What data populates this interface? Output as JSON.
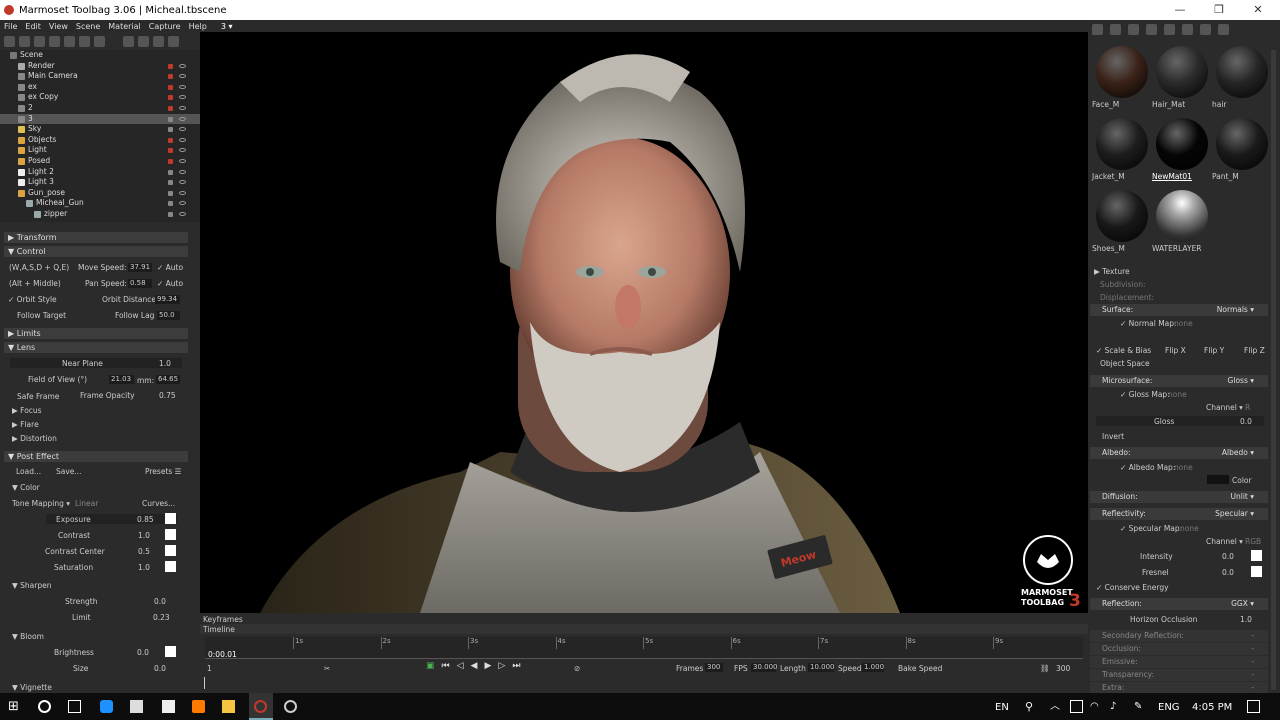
{
  "window": {
    "title": "Marmoset Toolbag 3.06  |  Micheal.tbscene",
    "minimize": "—",
    "maximize": "❐",
    "close": "✕"
  },
  "menu": [
    "File",
    "Edit",
    "View",
    "Scene",
    "Material",
    "Capture",
    "Help"
  ],
  "viewport_label": "3 ▾",
  "scene_tree": [
    {
      "name": "Scene",
      "indent": 0,
      "icon": "scene-icon",
      "lock": "none"
    },
    {
      "name": "Render",
      "indent": 1,
      "icon": "render-icon",
      "lock": "red"
    },
    {
      "name": "Main Camera",
      "indent": 1,
      "icon": "camera-icon",
      "lock": "red"
    },
    {
      "name": "ex",
      "indent": 1,
      "icon": "camera-icon",
      "lock": "red"
    },
    {
      "name": "ex Copy",
      "indent": 1,
      "icon": "camera-icon",
      "lock": "red"
    },
    {
      "name": "2",
      "indent": 1,
      "icon": "camera-icon",
      "lock": "red"
    },
    {
      "name": "3",
      "indent": 1,
      "icon": "camera-icon",
      "lock": "gray",
      "selected": true
    },
    {
      "name": "Sky",
      "indent": 1,
      "icon": "sky-icon",
      "lock": "gray"
    },
    {
      "name": "Objects",
      "indent": 1,
      "icon": "folder-icon",
      "lock": "red"
    },
    {
      "name": "Light",
      "indent": 1,
      "icon": "folder-icon",
      "lock": "red"
    },
    {
      "name": "Posed",
      "indent": 1,
      "icon": "folder-icon",
      "lock": "red"
    },
    {
      "name": "Light 2",
      "indent": 1,
      "icon": "light-icon",
      "lock": "gray"
    },
    {
      "name": "Light 3",
      "indent": 1,
      "icon": "light-icon",
      "lock": "gray"
    },
    {
      "name": "Gun_pose",
      "indent": 1,
      "icon": "folder-icon",
      "lock": "gray"
    },
    {
      "name": "Micheal_Gun",
      "indent": 2,
      "icon": "mesh-icon",
      "lock": "gray"
    },
    {
      "name": "zipper",
      "indent": 3,
      "icon": "mesh-icon",
      "lock": "gray"
    }
  ],
  "left": {
    "transform": "Transform",
    "control": "Control",
    "wasd": "(W,A,S,D + Q,E)",
    "move_speed_label": "Move Speed:",
    "move_speed": "37.91",
    "auto1": "✓ Auto",
    "alt_middle": "(Alt + Middle)",
    "pan_speed_label": "Pan Speed:",
    "pan_speed": "0.58",
    "auto2": "✓ Auto",
    "orbit_style": "✓ Orbit Style",
    "orbit_dist_label": "Orbit Distance:",
    "orbit_dist": "99.34",
    "follow_target": "Follow Target",
    "follow_lag_label": "Follow Lag",
    "follow_lag": "50.0",
    "limits": "Limits",
    "lens": "Lens",
    "near_plane_label": "Near Plane",
    "near_plane": "1.0",
    "fov_label": "Field of View (°)",
    "fov": "21.03",
    "mm_label": "mm:",
    "mm": "64.65",
    "safe_frame": "Safe Frame",
    "frame_opacity_label": "Frame Opacity",
    "frame_opacity": "0.75",
    "focus": "Focus",
    "flare": "Flare",
    "distortion": "Distortion",
    "post_effect": "Post Effect",
    "load": "Load...",
    "save": "Save...",
    "presets": "Presets ☰",
    "color": "Color",
    "tone_mapping": "Tone Mapping ▾",
    "tone_value": "Linear",
    "curves": "Curves...",
    "exposure_label": "Exposure",
    "exposure": "0.85",
    "contrast_label": "Contrast",
    "contrast": "1.0",
    "contrast_center_label": "Contrast Center",
    "contrast_center": "0.5",
    "saturation_label": "Saturation",
    "saturation": "1.0",
    "sharpen": "Sharpen",
    "strength_label": "Strength",
    "strength": "0.0",
    "limit_label": "Limit",
    "limit": "0.23",
    "bloom": "Bloom",
    "brightness_label": "Brightness",
    "brightness": "0.0",
    "size_label": "Size",
    "size": "0.0",
    "vignette": "Vignette"
  },
  "materials": [
    {
      "name": "Face_M",
      "color": "#3a2218"
    },
    {
      "name": "Hair_Mat",
      "color": "#2a2a2a"
    },
    {
      "name": "hair",
      "color": "#252525"
    },
    {
      "name": "Jacket_M",
      "color": "#1d1d1d"
    },
    {
      "name": "NewMat01",
      "color": "#050505"
    },
    {
      "name": "Pant_M",
      "color": "#1a1a1a"
    },
    {
      "name": "Shoes_M",
      "color": "#181818"
    },
    {
      "name": "WATERLAYER",
      "color": "#8a8a8a"
    }
  ],
  "right": {
    "texture": "Texture",
    "subdivision": "Subdivision:",
    "displacement": "Displacement:",
    "surface": "Surface:",
    "surface_val": "Normals ▾",
    "normal_map": "✓ Normal Map:",
    "normal_map_val": "none",
    "scale_bias": "✓ Scale & Bias",
    "flip_x": "Flip X",
    "flip_y": "Flip Y",
    "flip_z": "Flip Z",
    "object_space": "Object Space",
    "microsurface": "Microsurface:",
    "micro_val": "Gloss ▾",
    "gloss_map": "✓ Gloss Map:",
    "gloss_map_val": "none",
    "channel": "Channel ▾",
    "channel_r": "R",
    "gloss_label": "Gloss",
    "gloss": "0.0",
    "invert": "Invert",
    "albedo": "Albedo:",
    "albedo_val": "Albedo ▾",
    "albedo_map": "✓ Albedo Map:",
    "albedo_map_val": "none",
    "color_label": "Color",
    "diffusion": "Diffusion:",
    "diffusion_val": "Unlit ▾",
    "reflectivity": "Reflectivity:",
    "reflect_val": "Specular ▾",
    "spec_map": "✓ Specular Map:",
    "spec_map_val": "none",
    "channel_rgb": "RGB",
    "intensity_label": "Intensity",
    "intensity": "0.0",
    "fresnel_label": "Fresnel",
    "fresnel": "0.0",
    "conserve": "✓ Conserve Energy",
    "reflection": "Reflection:",
    "reflection_val": "GGX ▾",
    "horizon_label": "Horizon Occlusion",
    "horizon": "1.0",
    "secondary": "Secondary Reflection:",
    "occlusion": "Occlusion:",
    "emissive": "Emissive:",
    "transparency": "Transparency:",
    "extra": "Extra:"
  },
  "timeline": {
    "keyframes": "Keyframes",
    "timeline": "Timeline",
    "current": "0:00.01",
    "ticks": [
      "1s",
      "2s",
      "3s",
      "4s",
      "5s",
      "6s",
      "7s",
      "8s",
      "9s"
    ],
    "frame_start": "1",
    "frames_label": "Frames",
    "frames": "300",
    "fps_label": "FPS",
    "fps": "30.000",
    "length_label": "Length",
    "length": "10.000",
    "speed_label": "Speed",
    "speed": "1.000",
    "bake_speed": "Bake Speed",
    "end": "300"
  },
  "logo": {
    "line1": "MARMOSET",
    "line2": "TOOLBAG",
    "number": "3"
  },
  "badge_text": "Meow",
  "taskbar": {
    "lang": "EN",
    "lang2": "ENG",
    "time": "4:05 PM"
  }
}
